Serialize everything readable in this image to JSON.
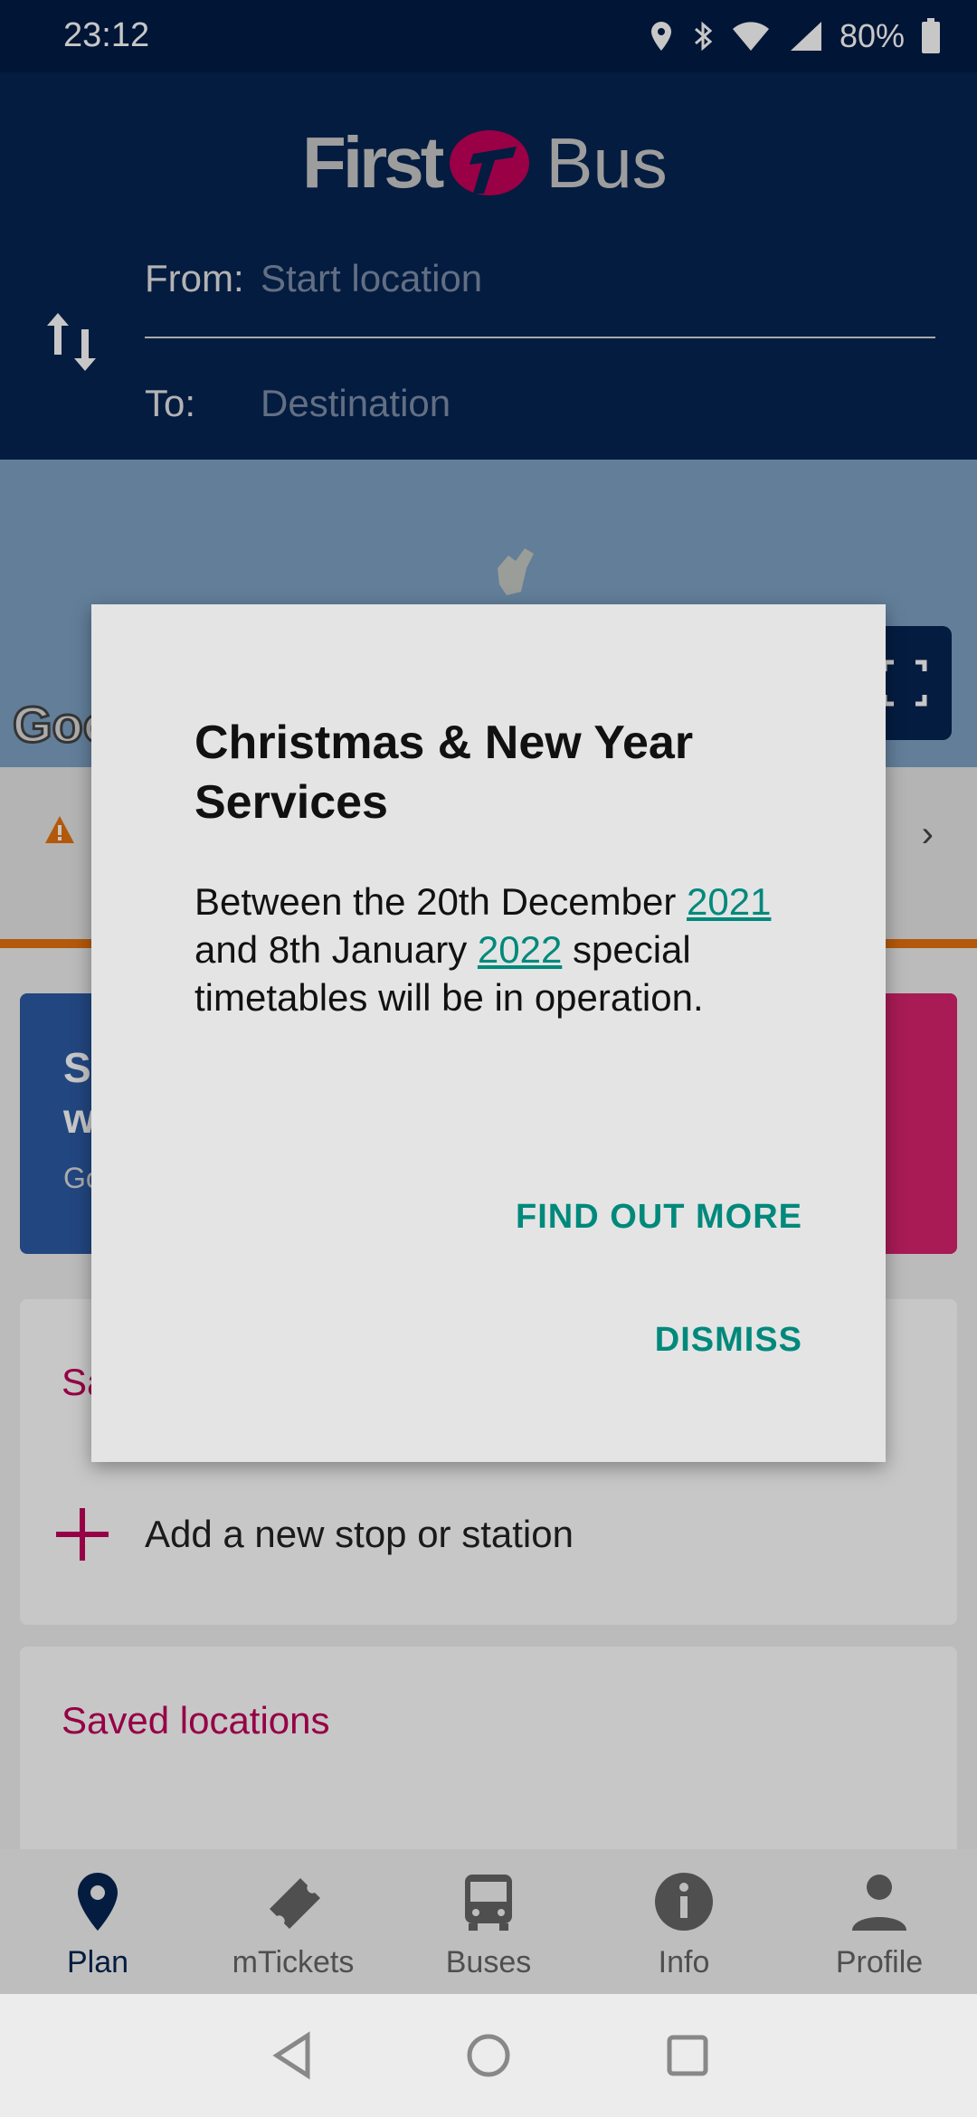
{
  "status_bar": {
    "time": "23:12",
    "battery": "80%"
  },
  "header": {
    "logo": {
      "first": "First",
      "bus": "Bus"
    },
    "from_label": "From:",
    "from_placeholder": "Start location",
    "to_label": "To:",
    "to_placeholder": "Destination"
  },
  "map": {
    "attribution": "Goo"
  },
  "cards": {
    "stops_title": "Sa",
    "add_stop_label": "Add a new stop or station",
    "saved_locations_title": "Saved locations"
  },
  "promo": {
    "line1": "S",
    "line2": "w",
    "line3": "Go"
  },
  "dialog": {
    "title": "Christmas & New Year Services",
    "body_part1": "Between the 20th December ",
    "body_link1": "2021",
    "body_part2": " and 8th January ",
    "body_link2": "2022",
    "body_part3": " special timetables will be in operation.",
    "find_out_more": "FIND OUT MORE",
    "dismiss": "DISMISS"
  },
  "bottom_nav": {
    "items": [
      {
        "label": "Plan",
        "icon": "map-pin-icon",
        "active": true
      },
      {
        "label": "mTickets",
        "icon": "ticket-icon",
        "active": false
      },
      {
        "label": "Buses",
        "icon": "bus-icon",
        "active": false
      },
      {
        "label": "Info",
        "icon": "info-icon",
        "active": false
      },
      {
        "label": "Profile",
        "icon": "person-icon",
        "active": false
      }
    ]
  },
  "colors": {
    "header_bg": "#062453",
    "accent_pink": "#c0005a",
    "link_teal": "#00897b",
    "alert_orange": "#e6730f"
  }
}
